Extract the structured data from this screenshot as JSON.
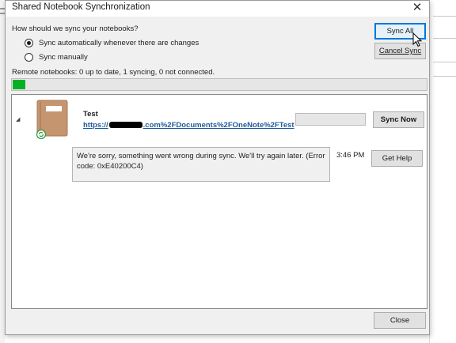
{
  "dialog": {
    "title": "Shared Notebook Synchronization",
    "close_glyph": "✕"
  },
  "sync_options": {
    "question": "How should we sync your notebooks?",
    "auto_label": "Sync automatically whenever there are changes",
    "manual_label": "Sync manually",
    "selected": "auto"
  },
  "buttons": {
    "sync_all": "Sync All",
    "cancel_sync": "Cancel Sync",
    "sync_now": "Sync Now",
    "get_help": "Get Help",
    "close": "Close"
  },
  "status": {
    "remote_summary": "Remote notebooks: 0 up to date, 1 syncing, 0 not connected.",
    "overall_progress": 0.03
  },
  "notebooks": [
    {
      "name": "Test",
      "link_prefix": "https://",
      "link_suffix": ".com%2FDocuments%2FOneNote%2FTest",
      "progress": 0,
      "error_message": "We're sorry, something went wrong during sync. We'll try again later. (Error code: 0xE40200C4)",
      "error_time": "3:46 PM"
    }
  ],
  "icons": {
    "notebook": "notebook-icon",
    "sync_badge": "sync-badge-icon",
    "expander": "collapse-triangle-icon",
    "cursor": "mouse-pointer-icon"
  },
  "colors": {
    "progress_green": "#06b025",
    "link_blue": "#1e5b9a",
    "notebook_tan": "#c4956f",
    "focus_blue": "#0078d7"
  }
}
